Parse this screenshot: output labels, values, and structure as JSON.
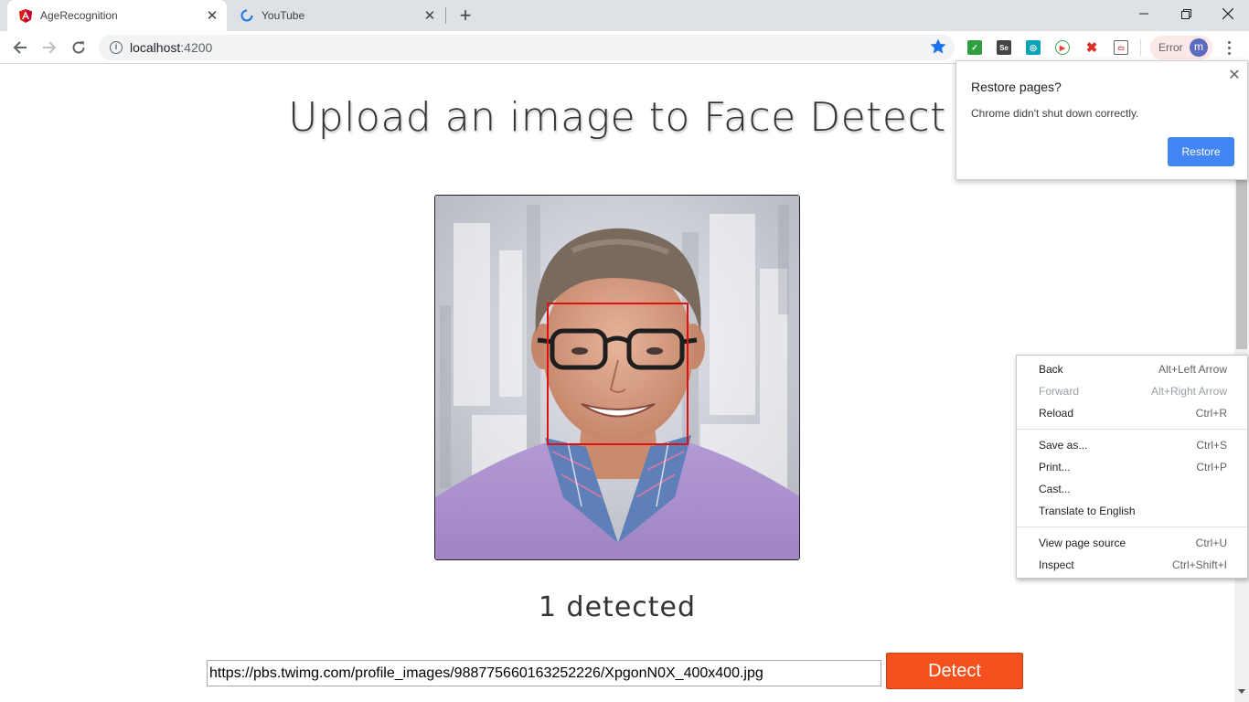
{
  "tabs": [
    {
      "title": "AgeRecognition",
      "icon": "angular-icon",
      "active": true
    },
    {
      "title": "YouTube",
      "icon": "loading-spinner-icon",
      "active": false
    }
  ],
  "window_controls": {
    "minimize": "─",
    "restore": "❐",
    "close": "✕"
  },
  "address_bar": {
    "host": "localhost",
    "port": ":4200"
  },
  "toolbar": {
    "error_label": "Error",
    "avatar_letter": "m"
  },
  "page": {
    "heading": "Upload an image to Face Detect",
    "detected_text": "1 detected",
    "image_url_value": "https://pbs.twimg.com/profile_images/988775660163252226/XpgonN0X_400x400.jpg",
    "detect_button": "Detect"
  },
  "restore_popup": {
    "title": "Restore pages?",
    "message": "Chrome didn't shut down correctly.",
    "button": "Restore"
  },
  "context_menu": {
    "groups": [
      [
        {
          "label": "Back",
          "shortcut": "Alt+Left Arrow",
          "enabled": true
        },
        {
          "label": "Forward",
          "shortcut": "Alt+Right Arrow",
          "enabled": false
        },
        {
          "label": "Reload",
          "shortcut": "Ctrl+R",
          "enabled": true
        }
      ],
      [
        {
          "label": "Save as...",
          "shortcut": "Ctrl+S",
          "enabled": true
        },
        {
          "label": "Print...",
          "shortcut": "Ctrl+P",
          "enabled": true
        },
        {
          "label": "Cast...",
          "shortcut": "",
          "enabled": true
        },
        {
          "label": "Translate to English",
          "shortcut": "",
          "enabled": true
        }
      ],
      [
        {
          "label": "View page source",
          "shortcut": "Ctrl+U",
          "enabled": true
        },
        {
          "label": "Inspect",
          "shortcut": "Ctrl+Shift+I",
          "enabled": true
        }
      ]
    ]
  },
  "colors": {
    "accent_button": "#f4511e",
    "restore_button": "#4285f4",
    "face_box": "#e01010",
    "star": "#1a73e8"
  }
}
